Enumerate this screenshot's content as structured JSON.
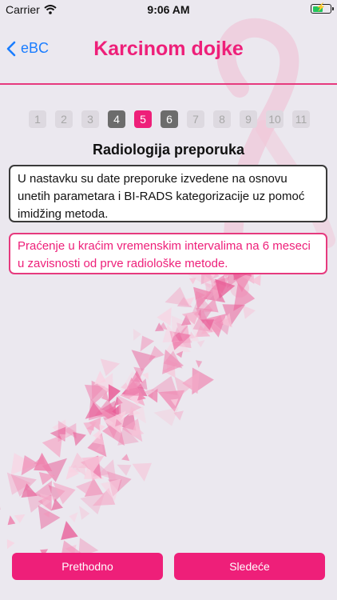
{
  "status_bar": {
    "carrier": "Carrier",
    "time": "9:06 AM",
    "battery_percent": 60
  },
  "nav": {
    "back_label": "eBC",
    "title": "Karcinom dojke"
  },
  "stepper": {
    "steps": [
      "1",
      "2",
      "3",
      "4",
      "5",
      "6",
      "7",
      "8",
      "9",
      "10",
      "11"
    ],
    "done": [
      3,
      5
    ],
    "active": 4
  },
  "content": {
    "section_title": "Radiologija preporuka",
    "info_text": "U nastavku su date preporuke izvedene na osnovu unetih parametara i BI-RADS kategorizacije uz pomoć imidžing metoda.",
    "recommendation": "Praćenje u kraćim vremenskim intervalima na 6 meseci u zavisnosti od prve radiološke metode."
  },
  "buttons": {
    "previous": "Prethodno",
    "next": "Sledeće"
  },
  "colors": {
    "accent": "#ee1f79",
    "link": "#1a7dff",
    "background": "#ebe8ef"
  },
  "icons": [
    "wifi-icon",
    "battery-icon",
    "chevron-left-icon"
  ]
}
